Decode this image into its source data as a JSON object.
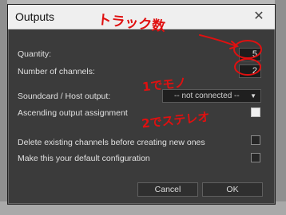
{
  "dialog": {
    "title": "Outputs",
    "quantity": {
      "label": "Quantity:",
      "value": "5"
    },
    "channels": {
      "label": "Number of channels:",
      "value": "2"
    },
    "soundcard": {
      "label": "Soundcard / Host output:",
      "value": "-- not connected --"
    },
    "ascending": {
      "label": "Ascending output assignment"
    },
    "delete_existing": {
      "label": "Delete existing channels before creating new ones"
    },
    "default_config": {
      "label": "Make this your default configuration"
    },
    "cancel_label": "Cancel",
    "ok_label": "OK"
  },
  "annotations": {
    "top_note": "トラック数",
    "note_line1": "1でモノ",
    "note_line2": "2でステレオ",
    "ink_color": "#e01010"
  },
  "colors": {
    "dialog_bg": "#3b3b3b",
    "titlebar_bg": "#efefef",
    "annotation_red": "#e01010"
  }
}
